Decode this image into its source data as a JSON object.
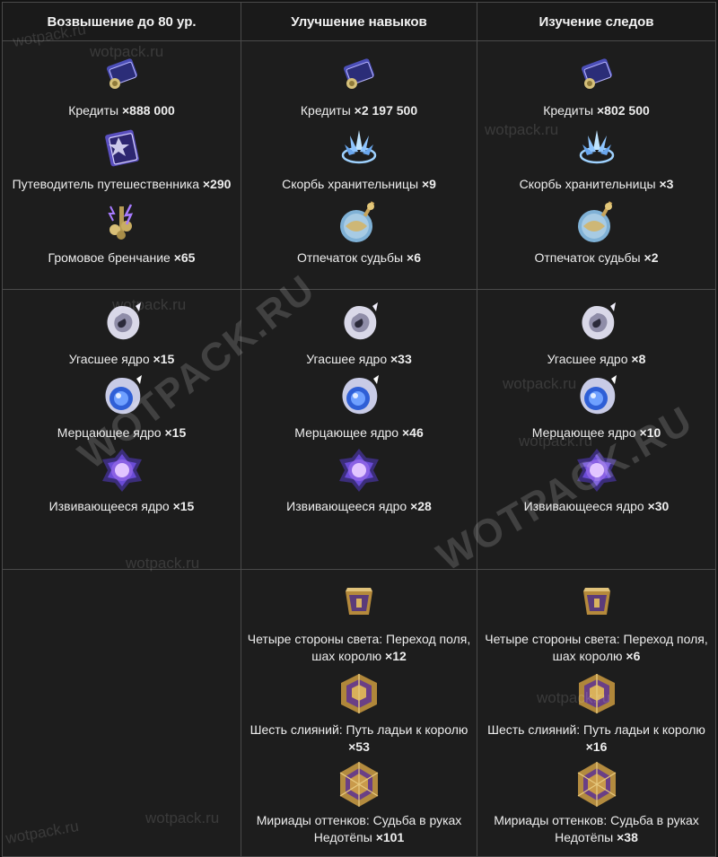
{
  "headers": [
    "Возвышение до 80 ур.",
    "Улучшение навыков",
    "Изучение следов"
  ],
  "sections": [
    [
      [
        {
          "icon": "credits-icon",
          "name": "Кредиты",
          "qty": "×888 000"
        },
        {
          "icon": "travel-guide-icon",
          "name": "Путеводитель путешественника",
          "qty": "×290"
        },
        {
          "icon": "thunder-chime-icon",
          "name": "Громовое бренчание",
          "qty": "×65"
        }
      ],
      [
        {
          "icon": "credits-icon",
          "name": "Кредиты",
          "qty": "×2 197 500"
        },
        {
          "icon": "crystal-sorrow-icon",
          "name": "Скорбь хранительницы",
          "qty": "×9"
        },
        {
          "icon": "fate-orb-icon",
          "name": "Отпечаток судьбы",
          "qty": "×6"
        }
      ],
      [
        {
          "icon": "credits-icon",
          "name": "Кредиты",
          "qty": "×802 500"
        },
        {
          "icon": "crystal-sorrow-icon",
          "name": "Скорбь хранительницы",
          "qty": "×3"
        },
        {
          "icon": "fate-orb-icon",
          "name": "Отпечаток судьбы",
          "qty": "×2"
        }
      ]
    ],
    [
      [
        {
          "icon": "extinguished-core-icon",
          "name": "Угасшее ядро",
          "qty": "×15"
        },
        {
          "icon": "glimmering-core-icon",
          "name": "Мерцающее ядро",
          "qty": "×15"
        },
        {
          "icon": "squirming-core-icon",
          "name": "Извивающееся ядро",
          "qty": "×15"
        }
      ],
      [
        {
          "icon": "extinguished-core-icon",
          "name": "Угасшее ядро",
          "qty": "×33"
        },
        {
          "icon": "glimmering-core-icon",
          "name": "Мерцающее ядро",
          "qty": "×46"
        },
        {
          "icon": "squirming-core-icon",
          "name": "Извивающееся ядро",
          "qty": "×28"
        }
      ],
      [
        {
          "icon": "extinguished-core-icon",
          "name": "Угасшее ядро",
          "qty": "×8"
        },
        {
          "icon": "glimmering-core-icon",
          "name": "Мерцающее ядро",
          "qty": "×10"
        },
        {
          "icon": "squirming-core-icon",
          "name": "Извивающееся ядро",
          "qty": "×30"
        }
      ]
    ],
    [
      [],
      [
        {
          "icon": "four-sides-prism-icon",
          "name": "Четыре стороны света: Переход поля, шах королю",
          "qty": "×12"
        },
        {
          "icon": "six-fusions-cube-icon",
          "name": "Шесть слияний: Путь ладьи к королю",
          "qty": "×53"
        },
        {
          "icon": "myriad-hues-dice-icon",
          "name": "Мириады оттенков: Судьба в руках Недотёпы",
          "qty": "×101"
        }
      ],
      [
        {
          "icon": "four-sides-prism-icon",
          "name": "Четыре стороны света: Переход поля, шах королю",
          "qty": "×6"
        },
        {
          "icon": "six-fusions-cube-icon",
          "name": "Шесть слияний: Путь ладьи к королю",
          "qty": "×16"
        },
        {
          "icon": "myriad-hues-dice-icon",
          "name": "Мириады оттенков: Судьба в руках Недотёпы",
          "qty": "×38"
        }
      ]
    ]
  ],
  "watermarks": {
    "small": "wotpack.ru",
    "big": "WOTPACK.RU"
  }
}
